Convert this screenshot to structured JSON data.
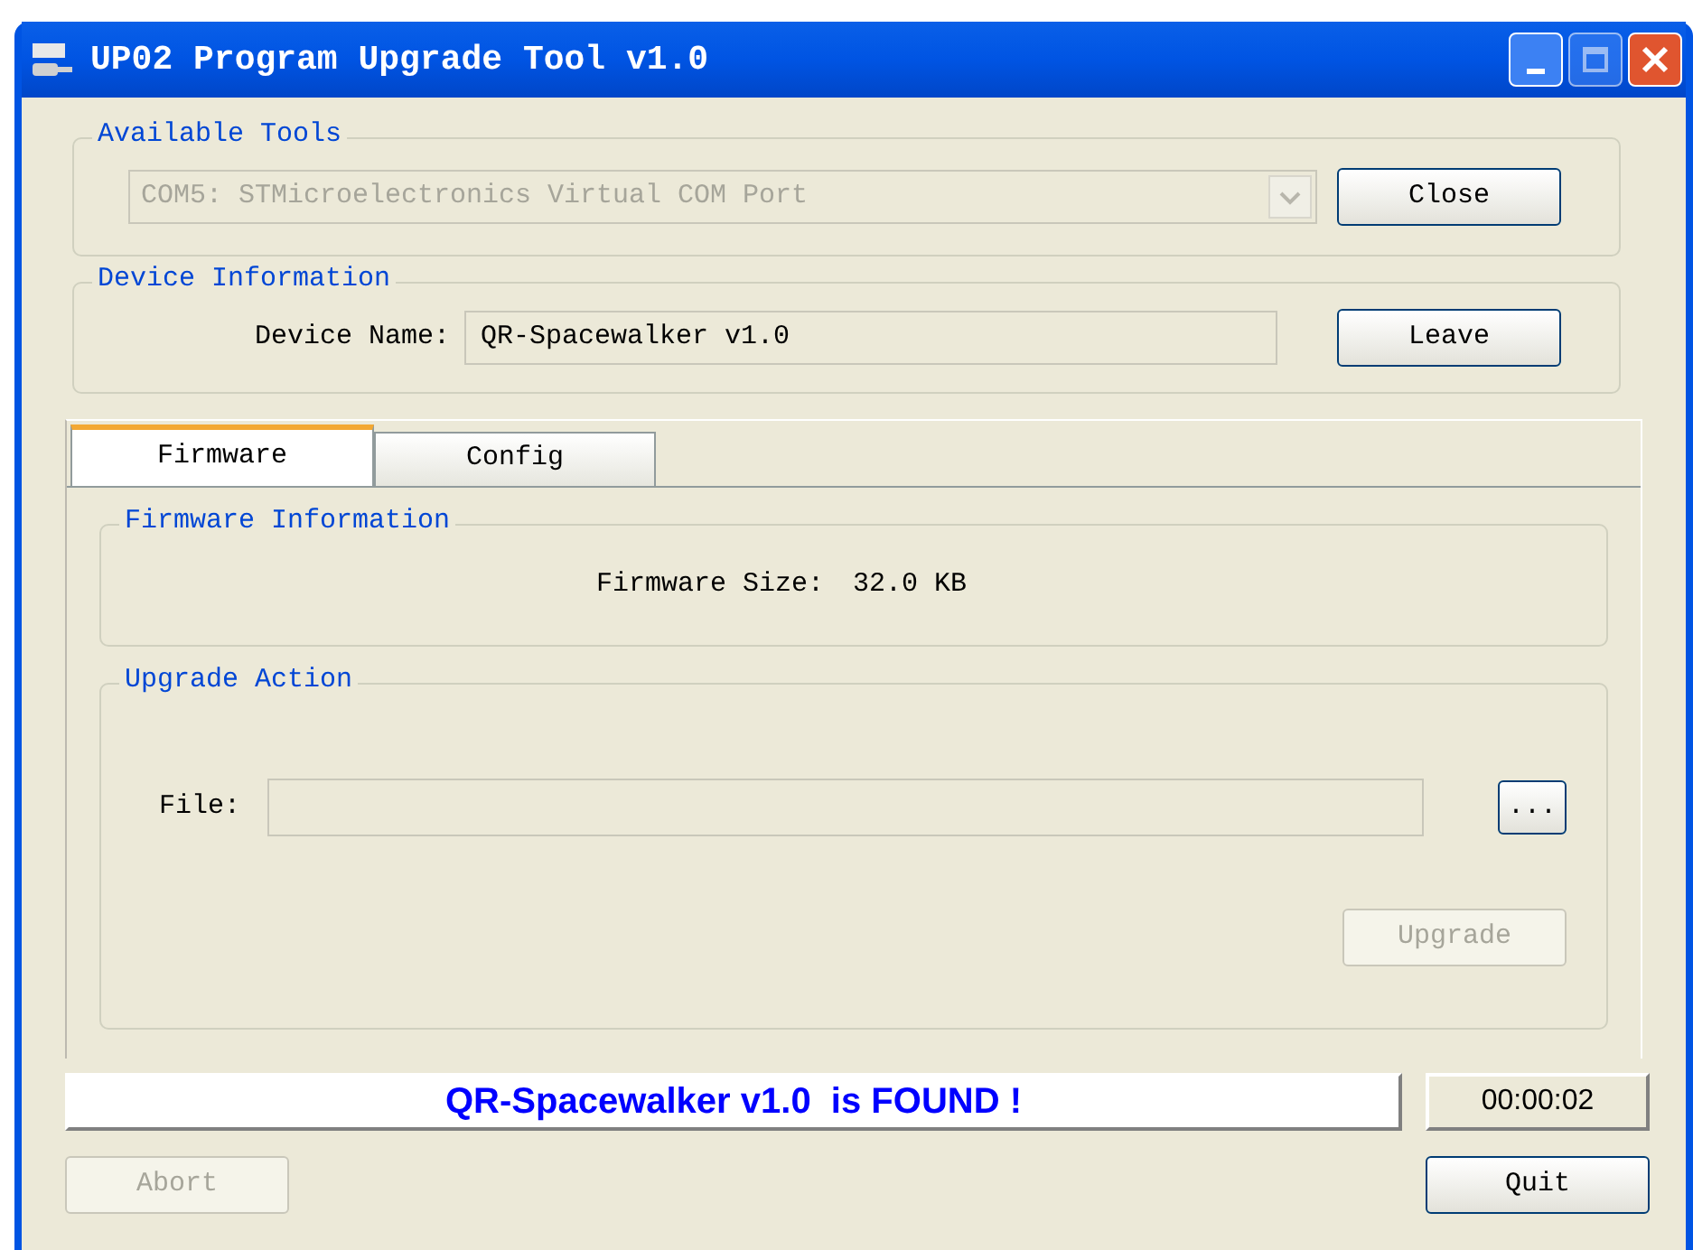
{
  "window": {
    "title": "UP02 Program Upgrade Tool v1.0"
  },
  "available_tools": {
    "title": "Available Tools",
    "port": {
      "value": "COM5: STMicroelectronics Virtual COM Port",
      "disabled": true
    },
    "button": "Close"
  },
  "device_information": {
    "title": "Device Information",
    "label": "Device Name:",
    "value": "QR-Spacewalker v1.0",
    "button": "Leave"
  },
  "tabs": [
    {
      "label": "Firmware",
      "selected": true
    },
    {
      "label": "Config",
      "selected": false
    }
  ],
  "firmware_information": {
    "title": "Firmware Information",
    "label": "Firmware Size:",
    "value": "32.0 KB"
  },
  "upgrade_action": {
    "title": "Upgrade Action",
    "file_label": "File:",
    "browse_button": "...",
    "upgrade_button": {
      "label": "Upgrade",
      "disabled": true
    }
  },
  "status": {
    "message": "QR-Spacewalker v1.0  is FOUND !",
    "timer": "00:00:02"
  },
  "buttons": [
    {
      "label": "Abort",
      "disabled": true
    },
    {
      "label": "Quit",
      "disabled": false
    }
  ]
}
